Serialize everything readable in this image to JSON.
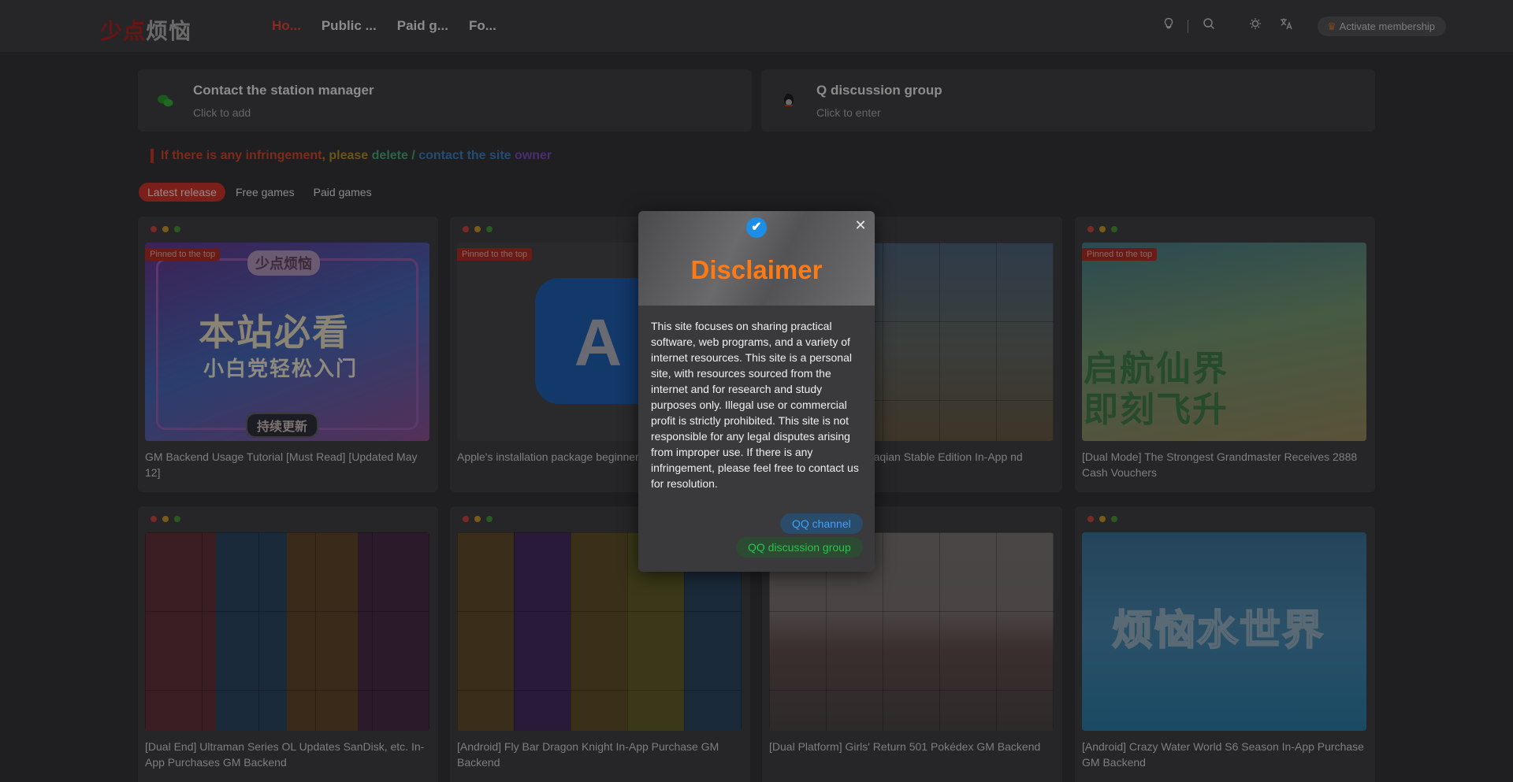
{
  "header": {
    "logo_text_red": "少点",
    "logo_text_grey": "烦恼",
    "nav": [
      {
        "label": "Ho...",
        "active": true
      },
      {
        "label": "Public ...",
        "active": false
      },
      {
        "label": "Paid g...",
        "active": false
      },
      {
        "label": "Fo...",
        "active": false
      }
    ],
    "icons": [
      "lightbulb-icon",
      "search-icon",
      "theme-sun-icon",
      "translate-icon"
    ],
    "member_label": "Activate membership"
  },
  "contacts": [
    {
      "title": "Contact the station manager",
      "subtitle": "Click to add",
      "icon": "wechat-icon"
    },
    {
      "title": "Q discussion group",
      "subtitle": "Click to enter",
      "icon": "qq-icon"
    }
  ],
  "notice": {
    "p1": "If there is any infringement",
    "p2": ", please ",
    "p3": "delete / ",
    "p4": "contact the site ",
    "p5": "owner"
  },
  "tabs": [
    {
      "label": "Latest release",
      "active": true
    },
    {
      "label": "Free games",
      "active": false
    },
    {
      "label": "Paid games",
      "active": false
    }
  ],
  "cards": [
    {
      "title": "GM Backend Usage Tutorial [Must Read] [Updated May 12]",
      "pinned": true,
      "pin_label": "Pinned to the top",
      "thumb_tag": "少点烦恼",
      "thumb_big": "本站必看",
      "thumb_mid": "小白党轻松入门",
      "thumb_bottom": "持续更新"
    },
    {
      "title": "Apple's installation package beginner",
      "pinned": true,
      "pin_label": "Pinned to the top",
      "thumb_icon": "A"
    },
    {
      "title": "ao Daqian Stable Edition In-App nd",
      "pinned": false
    },
    {
      "title": "[Dual Mode] The Strongest Grandmaster Receives 2888 Cash Vouchers",
      "pinned": true,
      "pin_label": "Pinned to the top",
      "thumb_big": "启航仙界\n即刻飞升"
    },
    {
      "title": "[Dual End] Ultraman Series OL Updates SanDisk, etc. In-App Purchases GM Backend",
      "pinned": false
    },
    {
      "title": "[Android] Fly Bar Dragon Knight In-App Purchase GM Backend",
      "pinned": false
    },
    {
      "title": "[Dual Platform] Girls' Return 501 Pokédex GM Backend",
      "pinned": false
    },
    {
      "title": "[Android] Crazy Water World S6 Season In-App Purchase GM Backend",
      "pinned": false,
      "thumb_big": "烦恼水世界"
    }
  ],
  "modal": {
    "title": "Disclaimer",
    "body": "This site focuses on sharing practical software, web programs, and a variety of internet resources. This site is a personal site, with resources sourced from the internet and for research and study purposes only. Illegal use or commercial profit is strictly prohibited. This site is not responsible for any legal disputes arising from improper use. If there is any infringement, please feel free to contact us for resolution.",
    "button_channel": "QQ channel",
    "button_group": "QQ discussion group",
    "close_glyph": "✕",
    "badge_glyph": "✔"
  },
  "colors": {
    "accent": "#ff7a12",
    "link_blue": "#3fa0ff",
    "link_green": "#22c84a",
    "brand_red": "#c0291f"
  }
}
